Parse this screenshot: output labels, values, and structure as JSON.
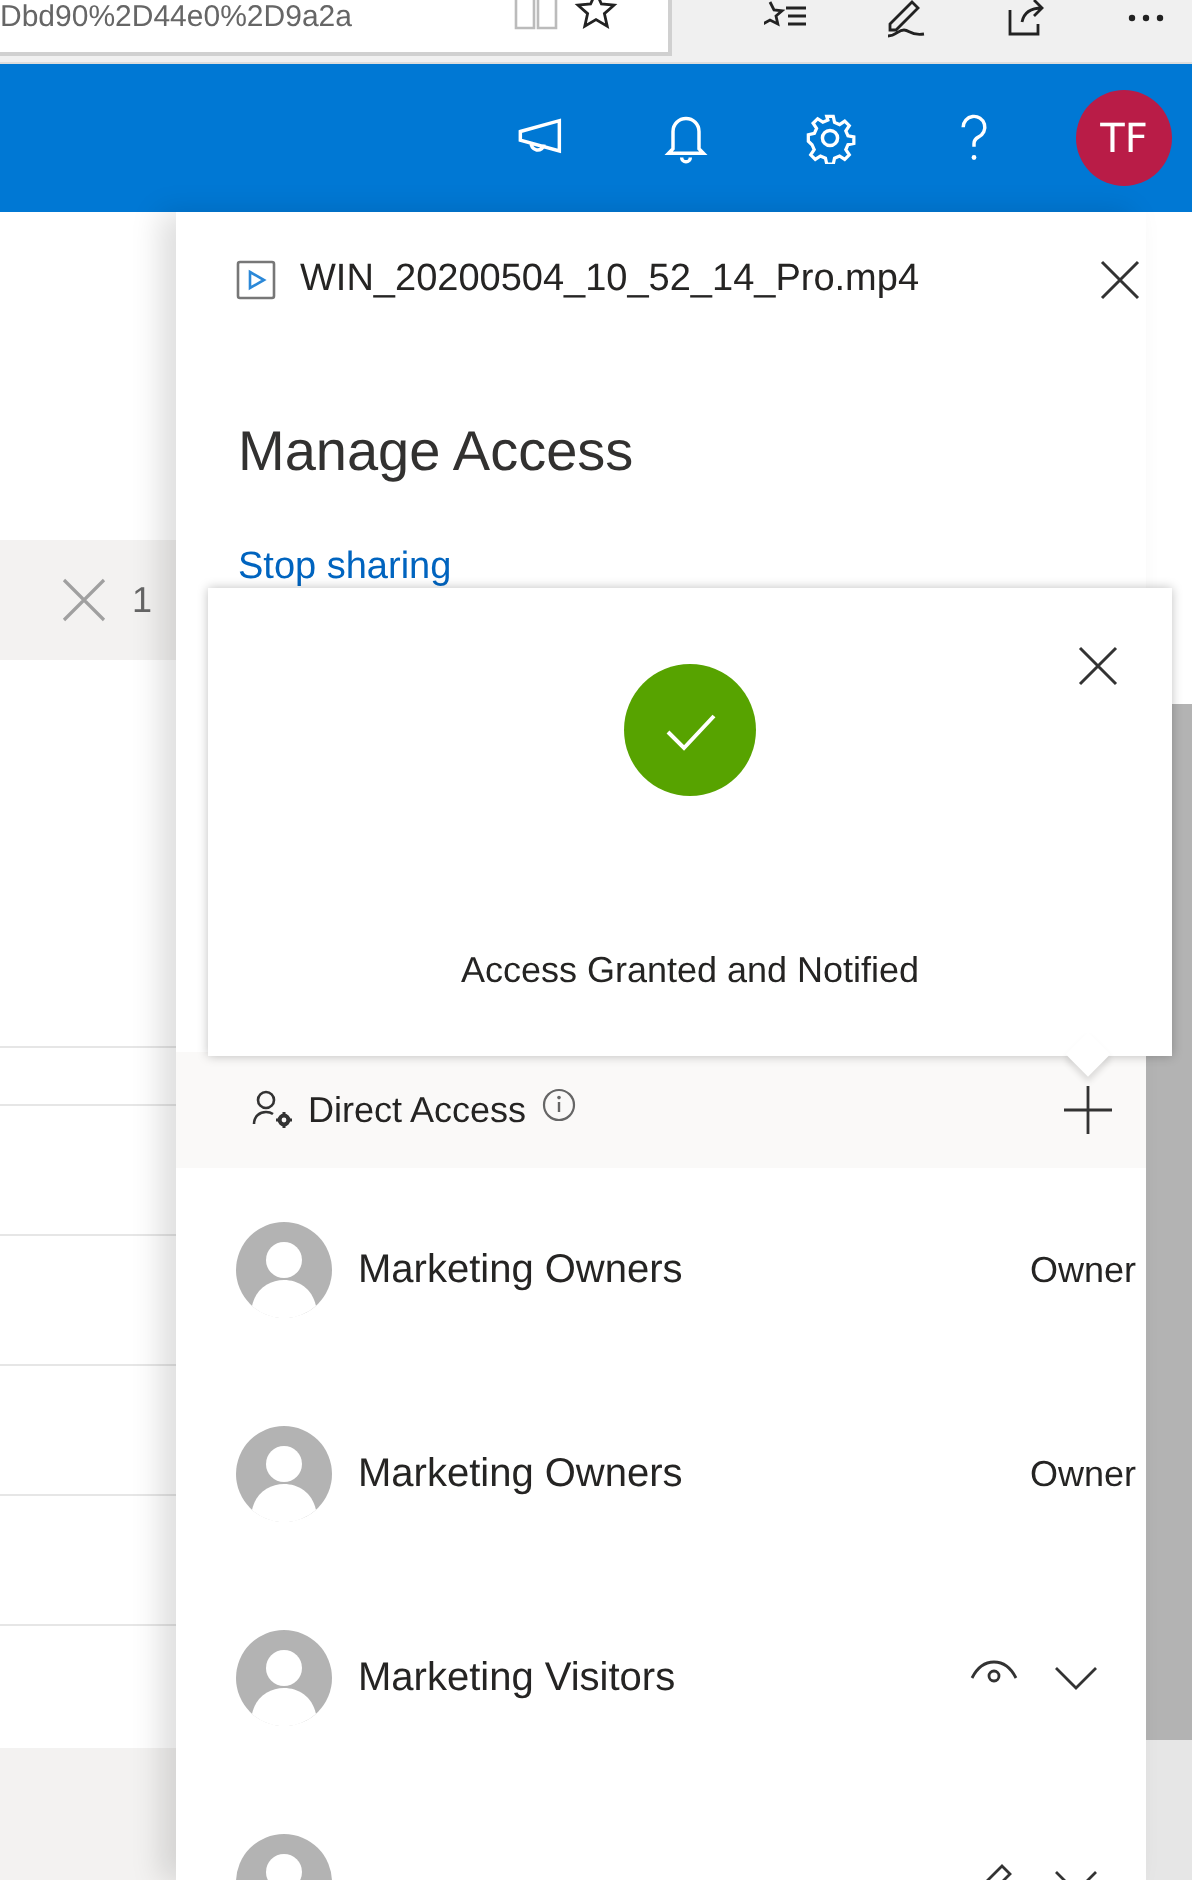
{
  "browser": {
    "address": "Dbd90%2D44e0%2D9a2a"
  },
  "suite_bar": {
    "avatar_initials": "TF"
  },
  "background": {
    "selection_count": "1"
  },
  "panel": {
    "file_name": "WIN_20200504_10_52_14_Pro.mp4",
    "title": "Manage Access",
    "stop_sharing_link": "Stop sharing",
    "popup": {
      "message": "Access Granted and Notified"
    },
    "direct_access": {
      "label": "Direct Access"
    },
    "members": [
      {
        "kind": "role",
        "name": "Marketing Owners",
        "role": "Owner"
      },
      {
        "kind": "role",
        "name": "Marketing Owners",
        "role": "Owner"
      },
      {
        "kind": "view",
        "name": "Marketing Visitors"
      },
      {
        "kind": "edit"
      }
    ]
  }
}
